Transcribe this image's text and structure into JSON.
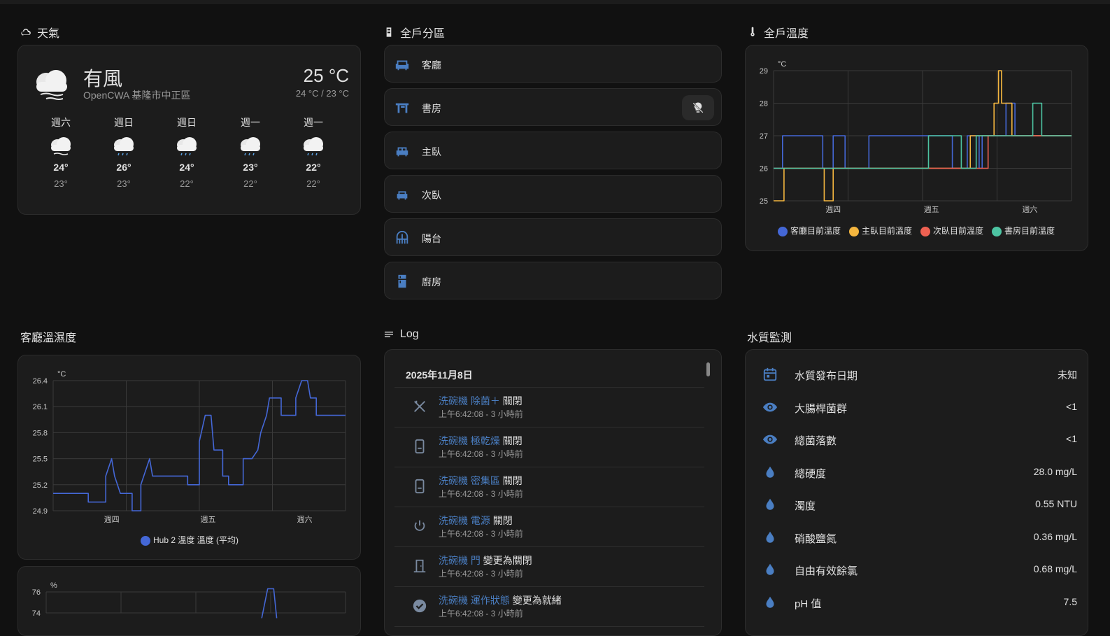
{
  "sections": {
    "weather": "天氣",
    "areas": "全戶分區",
    "temps": "全戶溫度",
    "living": "客廳溫濕度",
    "log": "Log",
    "water": "水質監測"
  },
  "weather": {
    "condition": "有風",
    "source": "OpenCWA 基隆市中正區",
    "temp": "25 °C",
    "range": "24 °C / 23 °C",
    "forecast": [
      {
        "day": "週六",
        "hi": "24°",
        "lo": "23°",
        "icon": "cloudy-windy-icon"
      },
      {
        "day": "週日",
        "hi": "26°",
        "lo": "23°",
        "icon": "rain-icon"
      },
      {
        "day": "週日",
        "hi": "24°",
        "lo": "22°",
        "icon": "rain-icon"
      },
      {
        "day": "週一",
        "hi": "23°",
        "lo": "22°",
        "icon": "rain-icon"
      },
      {
        "day": "週一",
        "hi": "22°",
        "lo": "22°",
        "icon": "rain-icon"
      }
    ]
  },
  "areas": [
    {
      "label": "客廳",
      "icon": "sofa-icon"
    },
    {
      "label": "書房",
      "icon": "desk-icon"
    },
    {
      "label": "主臥",
      "icon": "bed-icon"
    },
    {
      "label": "次臥",
      "icon": "bed-icon"
    },
    {
      "label": "陽台",
      "icon": "balcony-icon"
    },
    {
      "label": "廚房",
      "icon": "fridge-icon"
    }
  ],
  "log": {
    "date": "2025年11月8日",
    "items": [
      {
        "entity": "洗碗機 除菌＋",
        "action": "關閉",
        "time": "上午6:42:08 - 3 小時前",
        "icon": "sanitize-icon"
      },
      {
        "entity": "洗碗機 極乾燥",
        "action": "關閉",
        "time": "上午6:42:08 - 3 小時前",
        "icon": "device-icon"
      },
      {
        "entity": "洗碗機 密集區",
        "action": "關閉",
        "time": "上午6:42:08 - 3 小時前",
        "icon": "device-icon"
      },
      {
        "entity": "洗碗機 電源",
        "action": "關閉",
        "time": "上午6:42:08 - 3 小時前",
        "icon": "power-icon"
      },
      {
        "entity": "洗碗機 門",
        "action": "變更為關閉",
        "time": "上午6:42:08 - 3 小時前",
        "icon": "door-icon"
      },
      {
        "entity": "洗碗機 運作狀態",
        "action": "變更為就緒",
        "time": "上午6:42:08 - 3 小時前",
        "icon": "check-circle-icon"
      }
    ]
  },
  "water": [
    {
      "label": "水質發布日期",
      "value": "未知",
      "icon": "calendar-icon"
    },
    {
      "label": "大腸桿菌群",
      "value": "<1",
      "icon": "eye-icon"
    },
    {
      "label": "總菌落數",
      "value": "<1",
      "icon": "eye-icon"
    },
    {
      "label": "總硬度",
      "value": "28.0 mg/L",
      "icon": "water-drop-icon"
    },
    {
      "label": "濁度",
      "value": "0.55 NTU",
      "icon": "water-drop-icon"
    },
    {
      "label": "硝酸鹽氮",
      "value": "0.36 mg/L",
      "icon": "water-drop-icon"
    },
    {
      "label": "自由有效餘氯",
      "value": "0.68 mg/L",
      "icon": "water-drop-icon"
    },
    {
      "label": "pH 值",
      "value": "7.5",
      "icon": "water-drop-icon"
    }
  ],
  "colors": {
    "accent": "#4a7ec2",
    "blue": "#4467d6",
    "yellow": "#f4b63f",
    "red": "#ee6152",
    "teal": "#4dc4a2"
  },
  "chart_data": [
    {
      "type": "line",
      "unit": "°C",
      "ylim": [
        25,
        29
      ],
      "y_ticks": [
        "25",
        "26",
        "27",
        "28",
        "29"
      ],
      "x_ticks": [
        "週四",
        "週五",
        "週六"
      ],
      "series": [
        {
          "name": "客廳目前溫度",
          "color": "#4467d6",
          "points": [
            [
              0,
              26
            ],
            [
              0.03,
              26
            ],
            [
              0.03,
              27
            ],
            [
              0.165,
              27
            ],
            [
              0.165,
              26
            ],
            [
              0.2,
              26
            ],
            [
              0.2,
              27
            ],
            [
              0.24,
              27
            ],
            [
              0.24,
              26
            ],
            [
              0.32,
              26
            ],
            [
              0.32,
              27
            ],
            [
              0.6,
              27
            ],
            [
              0.6,
              26
            ],
            [
              0.65,
              26
            ],
            [
              0.65,
              27
            ],
            [
              0.69,
              27
            ],
            [
              0.69,
              26
            ],
            [
              0.7,
              26
            ],
            [
              0.7,
              27
            ],
            [
              0.78,
              27
            ],
            [
              0.78,
              28
            ],
            [
              0.81,
              28
            ],
            [
              0.81,
              27
            ],
            [
              1,
              27
            ]
          ]
        },
        {
          "name": "主臥目前溫度",
          "color": "#f4b63f",
          "points": [
            [
              0,
              25
            ],
            [
              0.035,
              25
            ],
            [
              0.035,
              26
            ],
            [
              0.17,
              26
            ],
            [
              0.17,
              25
            ],
            [
              0.2,
              25
            ],
            [
              0.2,
              26
            ],
            [
              0.66,
              26
            ],
            [
              0.66,
              27
            ],
            [
              0.74,
              27
            ],
            [
              0.74,
              28
            ],
            [
              0.755,
              28
            ],
            [
              0.755,
              29
            ],
            [
              0.765,
              29
            ],
            [
              0.765,
              28
            ],
            [
              0.8,
              28
            ],
            [
              0.8,
              27
            ],
            [
              1,
              27
            ]
          ]
        },
        {
          "name": "次臥目前溫度",
          "color": "#ee6152",
          "points": [
            [
              0,
              26
            ],
            [
              0.52,
              26
            ],
            [
              0.52,
              26
            ],
            [
              0.72,
              26
            ],
            [
              0.72,
              27
            ],
            [
              1,
              27
            ]
          ]
        },
        {
          "name": "書房目前溫度",
          "color": "#4dc4a2",
          "points": [
            [
              0,
              26
            ],
            [
              0.52,
              26
            ],
            [
              0.52,
              27
            ],
            [
              0.63,
              27
            ],
            [
              0.63,
              26
            ],
            [
              0.68,
              26
            ],
            [
              0.68,
              27
            ],
            [
              0.87,
              27
            ],
            [
              0.87,
              28
            ],
            [
              0.9,
              28
            ],
            [
              0.9,
              27
            ],
            [
              1,
              27
            ]
          ]
        }
      ]
    },
    {
      "type": "line",
      "unit": "°C",
      "ylim": [
        24.9,
        26.4
      ],
      "y_ticks": [
        "24.9",
        "25.2",
        "25.5",
        "25.8",
        "26.1",
        "26.4"
      ],
      "x_ticks": [
        "週四",
        "週五",
        "週六"
      ],
      "series": [
        {
          "name": "Hub 2 溫度 溫度 (平均)",
          "color": "#4467d6",
          "points": [
            [
              0,
              25.1
            ],
            [
              0.12,
              25.1
            ],
            [
              0.12,
              25.0
            ],
            [
              0.18,
              25.0
            ],
            [
              0.18,
              25.3
            ],
            [
              0.2,
              25.5
            ],
            [
              0.21,
              25.3
            ],
            [
              0.23,
              25.1
            ],
            [
              0.27,
              25.1
            ],
            [
              0.27,
              24.9
            ],
            [
              0.3,
              24.9
            ],
            [
              0.3,
              25.2
            ],
            [
              0.33,
              25.5
            ],
            [
              0.34,
              25.3
            ],
            [
              0.46,
              25.3
            ],
            [
              0.46,
              25.2
            ],
            [
              0.5,
              25.2
            ],
            [
              0.5,
              25.7
            ],
            [
              0.52,
              26.0
            ],
            [
              0.54,
              26.0
            ],
            [
              0.55,
              25.6
            ],
            [
              0.58,
              25.6
            ],
            [
              0.58,
              25.3
            ],
            [
              0.6,
              25.3
            ],
            [
              0.6,
              25.2
            ],
            [
              0.65,
              25.2
            ],
            [
              0.65,
              25.5
            ],
            [
              0.68,
              25.5
            ],
            [
              0.7,
              25.6
            ],
            [
              0.71,
              25.8
            ],
            [
              0.73,
              26.0
            ],
            [
              0.74,
              26.2
            ],
            [
              0.78,
              26.2
            ],
            [
              0.78,
              26.0
            ],
            [
              0.83,
              26.0
            ],
            [
              0.83,
              26.2
            ],
            [
              0.85,
              26.4
            ],
            [
              0.87,
              26.4
            ],
            [
              0.88,
              26.2
            ],
            [
              0.9,
              26.2
            ],
            [
              0.9,
              26.0
            ],
            [
              1,
              26.0
            ]
          ]
        }
      ]
    },
    {
      "type": "line",
      "unit": "%",
      "ylim": [
        74,
        76
      ],
      "y_ticks": [
        "74",
        "76"
      ],
      "x_ticks": [],
      "series": [
        {
          "name": "",
          "color": "#4467d6",
          "points": [
            [
              0.72,
              73.5
            ],
            [
              0.74,
              76.3
            ],
            [
              0.76,
              76.3
            ],
            [
              0.77,
              73.5
            ]
          ]
        }
      ]
    }
  ]
}
